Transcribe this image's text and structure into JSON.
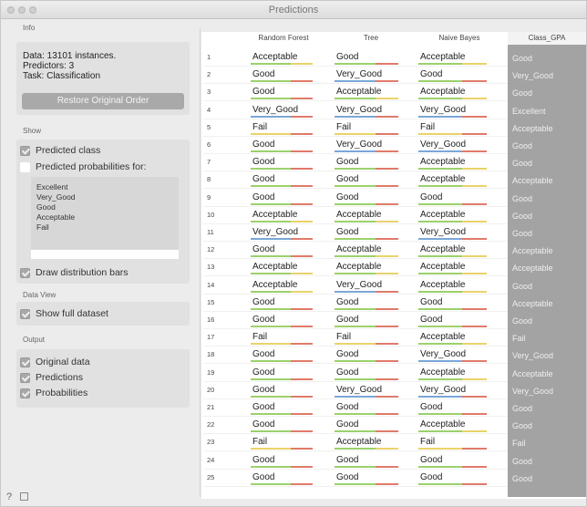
{
  "window": {
    "title": "Predictions"
  },
  "info": {
    "heading": "Info",
    "lines": [
      "Data: 13101 instances.",
      "Predictors: 3",
      "Task: Classification"
    ],
    "restore_button": "Restore Original Order"
  },
  "show": {
    "heading": "Show",
    "predicted_class": "Predicted class",
    "predicted_probabilities": "Predicted probabilities for:",
    "classes": [
      "Excellent",
      "Very_Good",
      "Good",
      "Acceptable",
      "Fail"
    ],
    "draw_distribution_bars": "Draw distribution bars"
  },
  "data_view": {
    "heading": "Data View",
    "show_full_dataset": "Show full dataset"
  },
  "output": {
    "heading": "Output",
    "items": [
      "Original data",
      "Predictions",
      "Probabilities"
    ]
  },
  "table": {
    "columns": [
      "Random Forest",
      "Tree",
      "Naive Bayes",
      "Class_GPA"
    ],
    "rows": [
      [
        "1",
        "Acceptable",
        "Good",
        "Acceptable",
        "Good"
      ],
      [
        "2",
        "Good",
        "Very_Good",
        "Good",
        "Very_Good"
      ],
      [
        "3",
        "Good",
        "Acceptable",
        "Acceptable",
        "Good"
      ],
      [
        "4",
        "Very_Good",
        "Very_Good",
        "Very_Good",
        "Excellent"
      ],
      [
        "5",
        "Fail",
        "Fail",
        "Fail",
        "Acceptable"
      ],
      [
        "6",
        "Good",
        "Very_Good",
        "Very_Good",
        "Good"
      ],
      [
        "7",
        "Good",
        "Good",
        "Acceptable",
        "Good"
      ],
      [
        "8",
        "Good",
        "Good",
        "Acceptable",
        "Acceptable"
      ],
      [
        "9",
        "Good",
        "Good",
        "Good",
        "Good"
      ],
      [
        "10",
        "Acceptable",
        "Acceptable",
        "Acceptable",
        "Good"
      ],
      [
        "11",
        "Very_Good",
        "Good",
        "Very_Good",
        "Good"
      ],
      [
        "12",
        "Good",
        "Acceptable",
        "Acceptable",
        "Acceptable"
      ],
      [
        "13",
        "Acceptable",
        "Acceptable",
        "Acceptable",
        "Acceptable"
      ],
      [
        "14",
        "Acceptable",
        "Very_Good",
        "Acceptable",
        "Good"
      ],
      [
        "15",
        "Good",
        "Good",
        "Good",
        "Acceptable"
      ],
      [
        "16",
        "Good",
        "Good",
        "Good",
        "Good"
      ],
      [
        "17",
        "Fail",
        "Fail",
        "Acceptable",
        "Fail"
      ],
      [
        "18",
        "Good",
        "Good",
        "Very_Good",
        "Very_Good"
      ],
      [
        "19",
        "Good",
        "Good",
        "Acceptable",
        "Acceptable"
      ],
      [
        "20",
        "Good",
        "Very_Good",
        "Very_Good",
        "Very_Good"
      ],
      [
        "21",
        "Good",
        "Good",
        "Good",
        "Good"
      ],
      [
        "22",
        "Good",
        "Good",
        "Acceptable",
        "Good"
      ],
      [
        "23",
        "Fail",
        "Acceptable",
        "Fail",
        "Fail"
      ],
      [
        "24",
        "Good",
        "Good",
        "Good",
        "Good"
      ],
      [
        "25",
        "Good",
        "Good",
        "Good",
        "Good"
      ]
    ]
  },
  "bar_colors": {
    "green": "#9bd16b",
    "red": "#e07a6a",
    "yellow": "#e9d36a",
    "blue": "#7aa7d8"
  },
  "icons": [
    "help-icon",
    "report-icon"
  ],
  "footer": {
    "help": "?"
  }
}
